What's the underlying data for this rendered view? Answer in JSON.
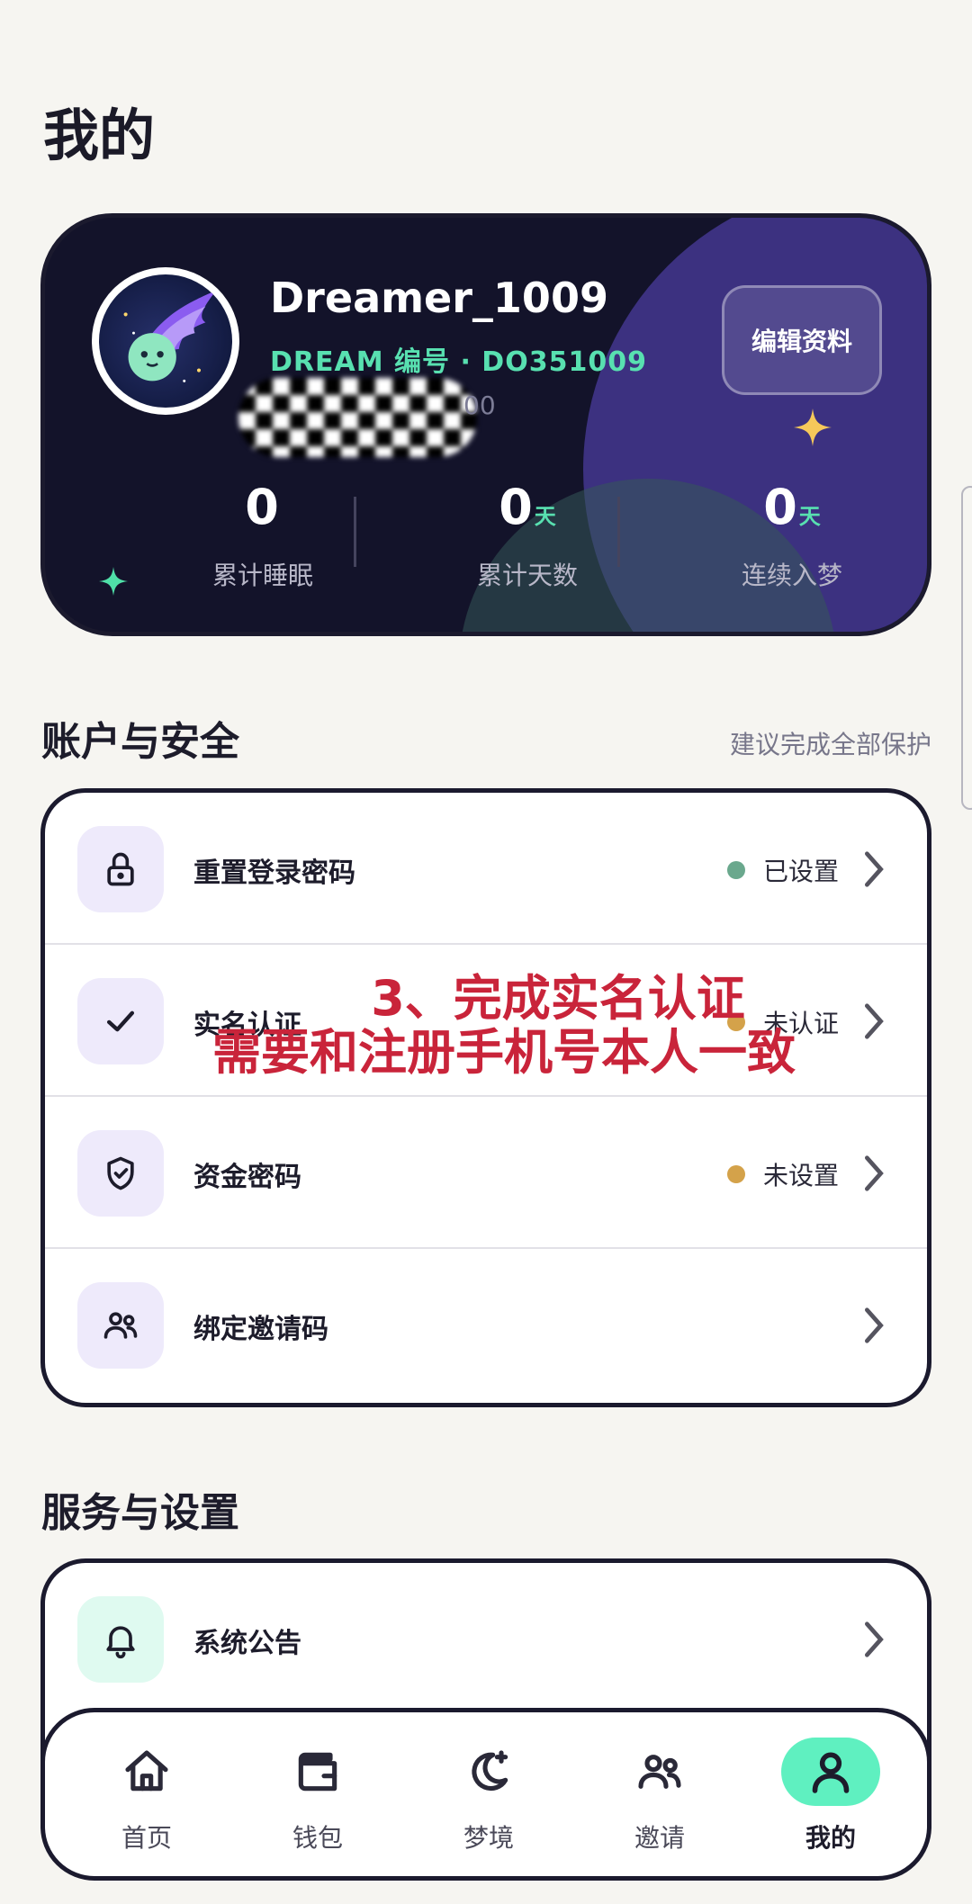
{
  "page": {
    "title": "我的"
  },
  "profile": {
    "username": "Dreamer_1009",
    "dream_id": "DREAM 编号 · DO351009",
    "redacted_tail": "00",
    "edit_label": "编辑资料",
    "stats": [
      {
        "value": "0",
        "unit": "",
        "label": "累计睡眠"
      },
      {
        "value": "0",
        "unit": "天",
        "label": "累计天数"
      },
      {
        "value": "0",
        "unit": "天",
        "label": "连续入梦"
      }
    ]
  },
  "account_section": {
    "title": "账户与安全",
    "hint": "建议完成全部保护",
    "items": [
      {
        "label": "重置登录密码",
        "status": "已设置",
        "status_color": "#6aa88d",
        "icon": "lock-icon"
      },
      {
        "label": "实名认证",
        "status": "未认证",
        "status_color": "#d4a24a",
        "icon": "check-icon"
      },
      {
        "label": "资金密码",
        "status": "未设置",
        "status_color": "#d4a24a",
        "icon": "shield-check-icon"
      },
      {
        "label": "绑定邀请码",
        "status": "",
        "status_color": "",
        "icon": "users-icon"
      }
    ]
  },
  "overlay": {
    "line1": "3、完成实名认证",
    "line2": "需要和注册手机号本人一致"
  },
  "services_section": {
    "title": "服务与设置",
    "items": [
      {
        "label": "系统公告",
        "icon": "bell-icon"
      }
    ]
  },
  "bottom_nav": {
    "items": [
      {
        "label": "首页",
        "icon": "home-icon",
        "active": false
      },
      {
        "label": "钱包",
        "icon": "wallet-icon",
        "active": false
      },
      {
        "label": "梦境",
        "icon": "moon-icon",
        "active": false
      },
      {
        "label": "邀请",
        "icon": "users-icon",
        "active": false
      },
      {
        "label": "我的",
        "icon": "person-icon",
        "active": true
      }
    ]
  },
  "colors": {
    "card_dark": "#13132a",
    "accent_mint": "#5ff0c0",
    "id_green": "#58e0b0",
    "overlay_red": "#c9243a"
  }
}
